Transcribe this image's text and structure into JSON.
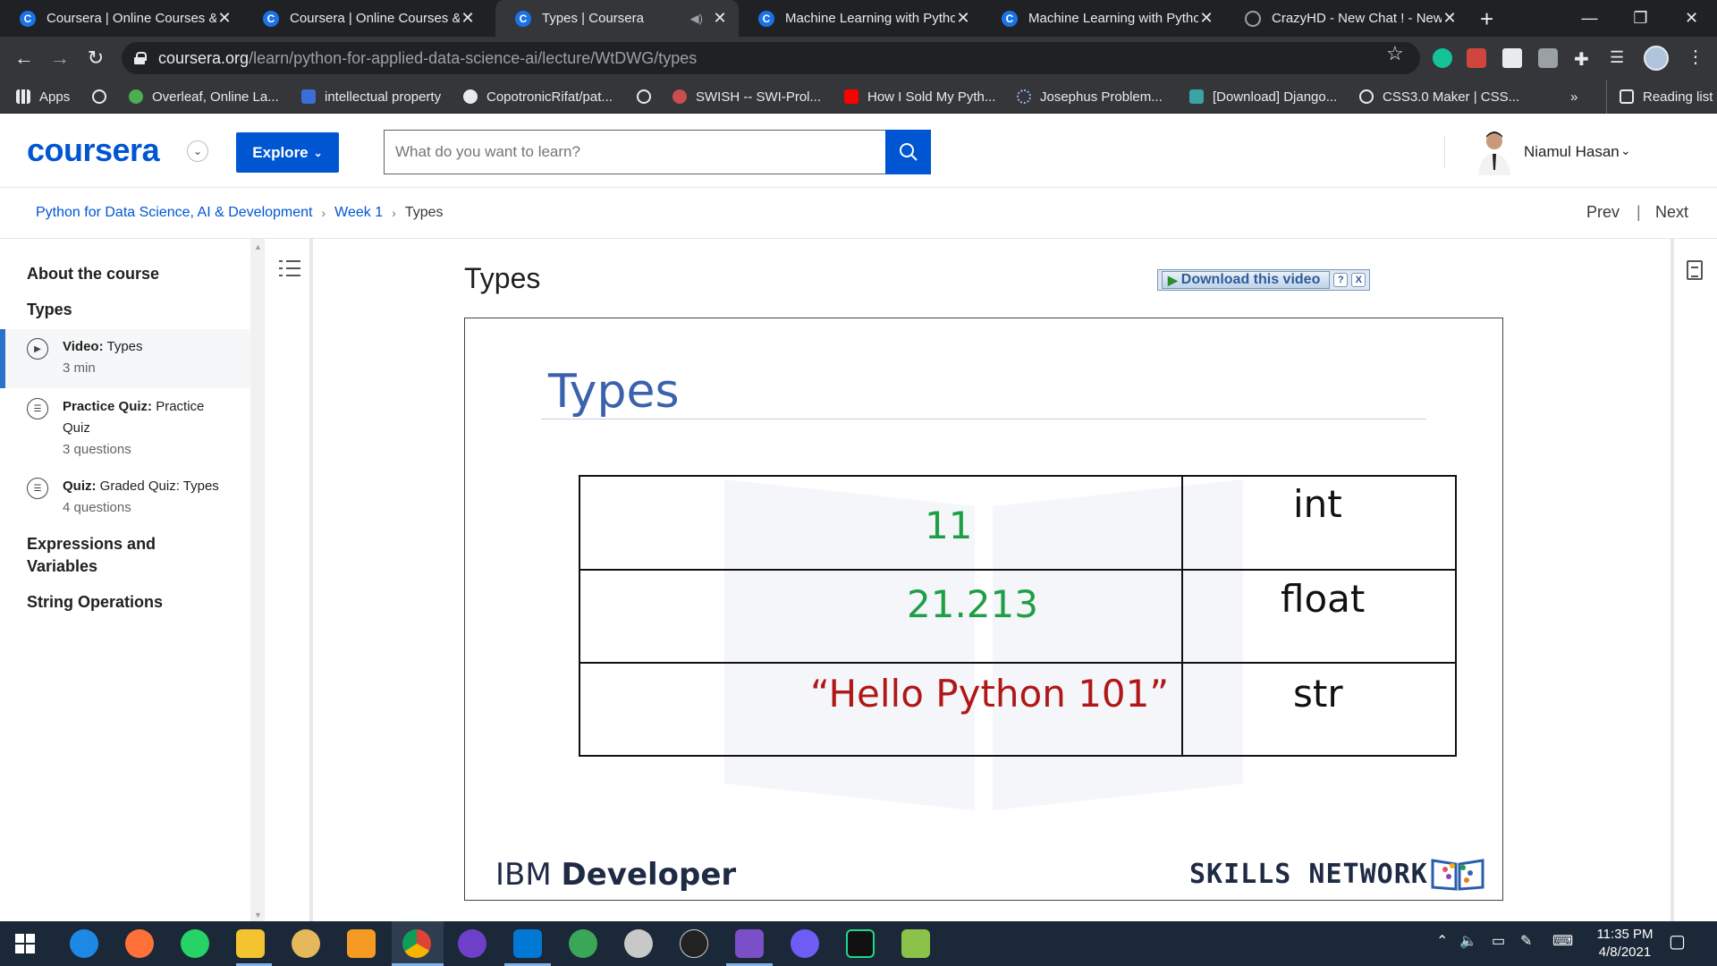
{
  "browser": {
    "tabs": [
      {
        "title": "Coursera | Online Courses & Credentials",
        "icon": "coursera-icon",
        "active": false
      },
      {
        "title": "Coursera | Online Courses & Credentials",
        "icon": "coursera-icon",
        "active": false
      },
      {
        "title": "Types | Coursera",
        "icon": "coursera-icon",
        "active": true
      },
      {
        "title": "Machine Learning with Python",
        "icon": "coursera-icon",
        "active": false
      },
      {
        "title": "Machine Learning with Python",
        "icon": "coursera-icon",
        "active": false
      },
      {
        "title": "CrazyHD - New Chat ! - New",
        "icon": "globe-icon",
        "active": false
      }
    ],
    "url_host": "coursera.org",
    "url_path": "/learn/python-for-applied-data-science-ai/lecture/WtDWG/types",
    "bookmarks": [
      {
        "label": "Apps",
        "icon": "apps-grid-icon"
      },
      {
        "label": "",
        "icon": "globe-icon"
      },
      {
        "label": "Overleaf, Online La...",
        "icon": "overleaf-icon"
      },
      {
        "label": "intellectual property",
        "icon": "s-icon"
      },
      {
        "label": "CopotronicRifat/pat...",
        "icon": "github-icon"
      },
      {
        "label": "",
        "icon": "globe-icon"
      },
      {
        "label": "SWISH -- SWI-Prol...",
        "icon": "swish-icon"
      },
      {
        "label": "How I Sold My Pyth...",
        "icon": "youtube-icon"
      },
      {
        "label": "Josephus Problem...",
        "icon": "loading-icon"
      },
      {
        "label": "[Download] Django...",
        "icon": "django-icon"
      },
      {
        "label": "CSS3.0 Maker | CSS...",
        "icon": "globe-icon"
      }
    ],
    "bookmarks_overflow": "»",
    "reading_list": "Reading list"
  },
  "header": {
    "logo": "coursera",
    "explore_label": "Explore",
    "search_placeholder": "What do you want to learn?",
    "user_name": "Niamul Hasan"
  },
  "breadcrumb": {
    "course": "Python for Data Science, AI & Development",
    "week": "Week 1",
    "current": "Types",
    "separator": "›",
    "prev": "Prev",
    "next": "Next",
    "pn_separator": "|"
  },
  "sidebar": {
    "about": "About the course",
    "section": "Types",
    "items": [
      {
        "type": "Video:",
        "name": "Types",
        "meta": "3 min",
        "icon": "play-circle-icon",
        "active": true
      },
      {
        "type": "Practice Quiz:",
        "name": "Practice Quiz",
        "meta": "3 questions",
        "icon": "quiz-icon",
        "active": false
      },
      {
        "type": "Quiz:",
        "name": "Graded Quiz: Types",
        "meta": "4 questions",
        "icon": "quiz-icon",
        "active": false
      }
    ],
    "more_sections": [
      "Expressions and Variables",
      "String Operations"
    ]
  },
  "lesson": {
    "title": "Types",
    "download_label": "Download this video",
    "download_help": "?",
    "download_close": "X"
  },
  "slide": {
    "title": "Types",
    "rows": [
      {
        "value": "11",
        "type": "int",
        "value_color": "#1e9e45"
      },
      {
        "value": "21.213",
        "type": "float",
        "value_color": "#1e9e45"
      },
      {
        "value": "“Hello Python 101”",
        "type": "str",
        "value_color": "#b01818"
      }
    ],
    "footer_left_light": "IBM ",
    "footer_left_bold": "Developer",
    "footer_right": "SKILLS NETWORK"
  },
  "taskbar": {
    "apps": [
      "windows-start-icon",
      "browser-icon",
      "firefox-icon",
      "whatsapp-icon",
      "file-explorer-icon",
      "tor-icon",
      "app-icon",
      "chrome-icon",
      "github-desktop-icon",
      "vscode-icon",
      "earth-icon",
      "app-icon",
      "inkscape-icon",
      "visual-studio-icon",
      "messenger-icon",
      "pycharm-icon",
      "notepad-icon"
    ],
    "time": "11:35 PM",
    "date": "4/8/2021"
  },
  "colors": {
    "coursera_blue": "#0056d2",
    "chrome_dark": "#35363a",
    "taskbar": "#1b2838"
  }
}
